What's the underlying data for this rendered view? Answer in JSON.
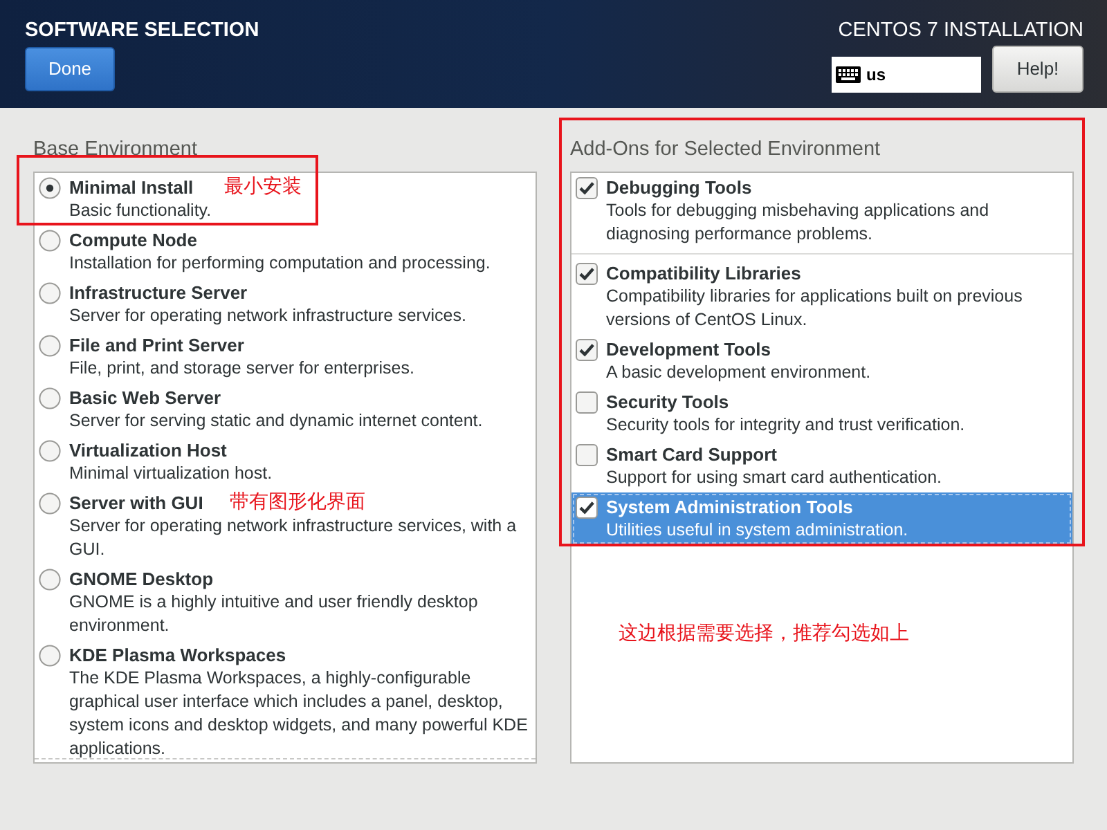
{
  "header": {
    "title": "SOFTWARE SELECTION",
    "done_button": "Done",
    "product": "CENTOS 7 INSTALLATION",
    "keyboard_layout": "us",
    "help_button": "Help!"
  },
  "base_environment": {
    "label": "Base Environment",
    "options": [
      {
        "name": "Minimal Install",
        "description": "Basic functionality.",
        "selected": true,
        "annotated": true,
        "note": "最小安装"
      },
      {
        "name": "Compute Node",
        "description": "Installation for performing computation and processing.",
        "selected": false
      },
      {
        "name": "Infrastructure Server",
        "description": "Server for operating network infrastructure services.",
        "selected": false
      },
      {
        "name": "File and Print Server",
        "description": "File, print, and storage server for enterprises.",
        "selected": false
      },
      {
        "name": "Basic Web Server",
        "description": "Server for serving static and dynamic internet content.",
        "selected": false
      },
      {
        "name": "Virtualization Host",
        "description": "Minimal virtualization host.",
        "selected": false
      },
      {
        "name": "Server with GUI",
        "description": "Server for operating network infrastructure services, with a GUI.",
        "selected": false,
        "note": "带有图形化界面"
      },
      {
        "name": "GNOME Desktop",
        "description": "GNOME is a highly intuitive and user friendly desktop environment.",
        "selected": false
      },
      {
        "name": "KDE Plasma Workspaces",
        "description": "The KDE Plasma Workspaces, a highly-configurable graphical user interface which includes a panel, desktop, system icons and desktop widgets, and many powerful KDE applications.",
        "selected": false
      }
    ]
  },
  "addons": {
    "label": "Add-Ons for Selected Environment",
    "annotated": true,
    "note": "这边根据需要选择，推荐勾选如上",
    "items": [
      {
        "name": "Debugging Tools",
        "description": "Tools for debugging misbehaving applications and diagnosing performance problems.",
        "checked": true,
        "selected": false,
        "divider_below": true
      },
      {
        "name": "Compatibility Libraries",
        "description": "Compatibility libraries for applications built on previous versions of CentOS Linux.",
        "checked": true,
        "selected": false
      },
      {
        "name": "Development Tools",
        "description": "A basic development environment.",
        "checked": true,
        "selected": false
      },
      {
        "name": "Security Tools",
        "description": "Security tools for integrity and trust verification.",
        "checked": false,
        "selected": false
      },
      {
        "name": "Smart Card Support",
        "description": "Support for using smart card authentication.",
        "checked": false,
        "selected": false
      },
      {
        "name": "System Administration Tools",
        "description": "Utilities useful in system administration.",
        "checked": true,
        "selected": true
      }
    ]
  }
}
